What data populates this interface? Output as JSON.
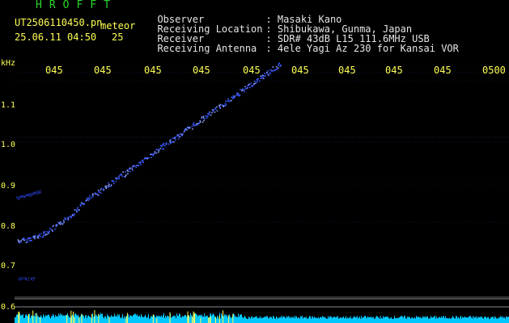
{
  "header": {
    "app_title": "HROFFT",
    "filename": "UT2506110450.pn",
    "mode": "meteor",
    "datetime": "25.06.11 04:50",
    "count": "25"
  },
  "info": [
    {
      "key": "Observer",
      "sep": ":",
      "value": "Masaki Kano"
    },
    {
      "key": "Receiving Location",
      "sep": ":",
      "value": "Shibukawa, Gunma, Japan"
    },
    {
      "key": "Receiver",
      "sep": ":",
      "value": "SDR# 43dB L15 111.6MHz USB"
    },
    {
      "key": "Receiving Antenna",
      "sep": ":",
      "value": "4ele Yagi Az 230 for Kansai VOR"
    }
  ],
  "axes": {
    "y_unit": "kHz",
    "y_ticks": [
      "1.1",
      "1.0",
      "0.9",
      "0.8",
      "0.7",
      "0.6"
    ],
    "x_ticks": [
      "045",
      "045",
      "045",
      "045",
      "045",
      "045",
      "045",
      "045",
      "045",
      "0500"
    ]
  },
  "colors": {
    "background": "#000000",
    "trace": "#3a58ff",
    "axis_text": "#ffff55",
    "title": "#2bd52b",
    "info_text": "#e6e6e6",
    "spectrum": "#00c8ff"
  }
}
